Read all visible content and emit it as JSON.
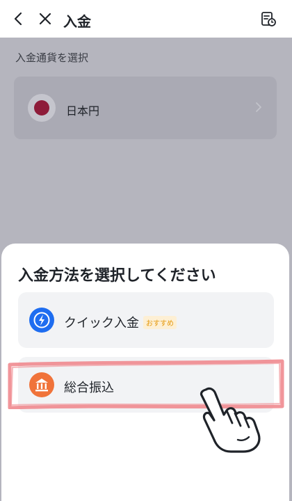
{
  "header": {
    "title": "入金",
    "back_icon": "chevron-left-icon",
    "close_icon": "close-icon",
    "history_icon": "receipt-clock-icon"
  },
  "currency_section": {
    "label": "入金通貨を選択",
    "selected_currency": "日本円",
    "flag_icon": "japan-flag-icon",
    "flag_color": "#8e1c3a"
  },
  "sheet": {
    "title": "入金方法を選択してください",
    "methods": [
      {
        "label": "クイック入金",
        "badge": "おすすめ",
        "icon": "lightning-icon",
        "icon_color": "#1e6df0"
      },
      {
        "label": "総合振込",
        "icon": "bank-icon",
        "icon_color": "#f0733a"
      }
    ]
  },
  "colors": {
    "overlay": "#b5b5be",
    "highlight_stroke": "#f08a8f",
    "badge_text": "#e59a10",
    "badge_bg": "#fdefd4"
  }
}
